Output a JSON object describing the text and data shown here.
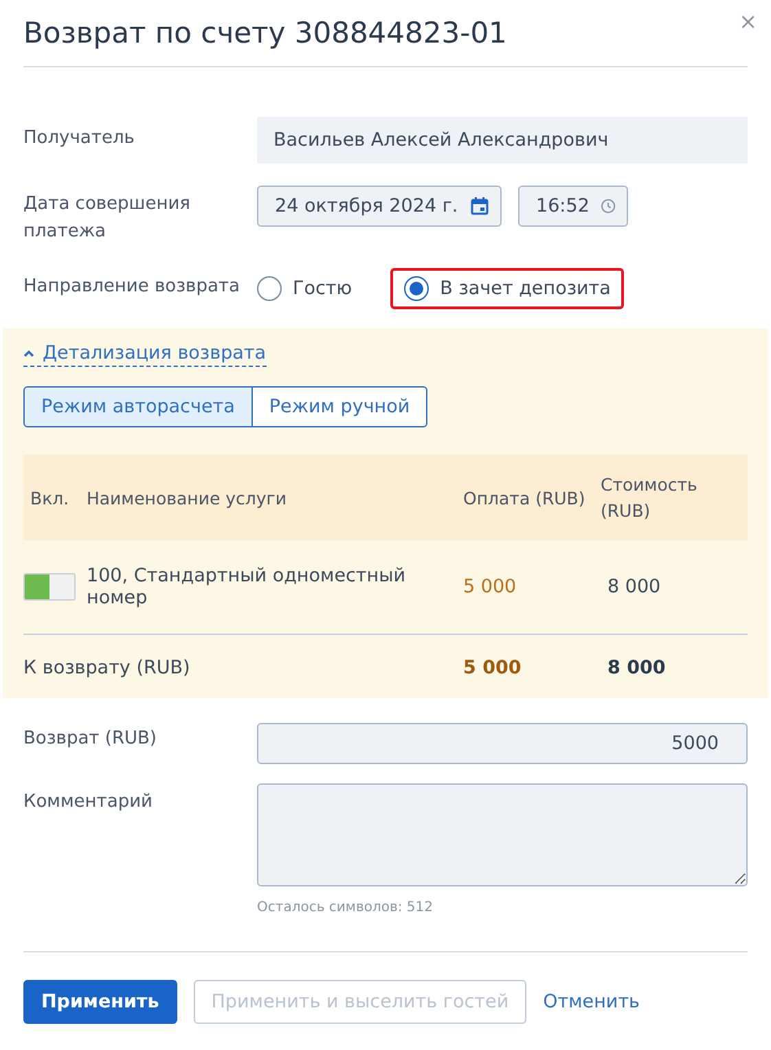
{
  "dialog": {
    "title": "Возврат по счету 308844823-01",
    "close": "×"
  },
  "recipient": {
    "label": "Получатель",
    "value": "Васильев Алексей Александрович"
  },
  "payment_date": {
    "label": "Дата совершения платежа",
    "date": "24 октября 2024 г.",
    "time": "16:52"
  },
  "direction": {
    "label": "Направление возврата",
    "options": [
      {
        "label": "Гостю",
        "selected": false,
        "highlighted": false
      },
      {
        "label": "В зачет депозита",
        "selected": true,
        "highlighted": true
      }
    ]
  },
  "details": {
    "toggle": "Детализация возврата",
    "expanded": true,
    "modes": [
      {
        "label": "Режим авторасчета",
        "selected": true
      },
      {
        "label": "Режим ручной",
        "selected": false
      }
    ],
    "table": {
      "columns": [
        "Вкл.",
        "Наименование услуги",
        "Оплата (RUB)",
        "Стоимость (RUB)"
      ],
      "rows": [
        {
          "on": true,
          "service": "100, Стандартный одноместный номер",
          "payment": "5 000",
          "cost": "8 000"
        }
      ],
      "total": {
        "label": "К возврату (RUB)",
        "payment": "5 000",
        "cost": "8 000"
      }
    }
  },
  "refund": {
    "label": "Возврат (RUB)",
    "value": "5000"
  },
  "comment": {
    "label": "Комментарий",
    "hint": "Осталось символов: 512"
  },
  "buttons": [
    {
      "label": "Применить",
      "kind": "primary",
      "disabled": false
    },
    {
      "label": "Применить и выселить гостей",
      "kind": "secondary",
      "disabled": true
    },
    {
      "label": "Отменить",
      "kind": "link",
      "disabled": false
    }
  ]
}
